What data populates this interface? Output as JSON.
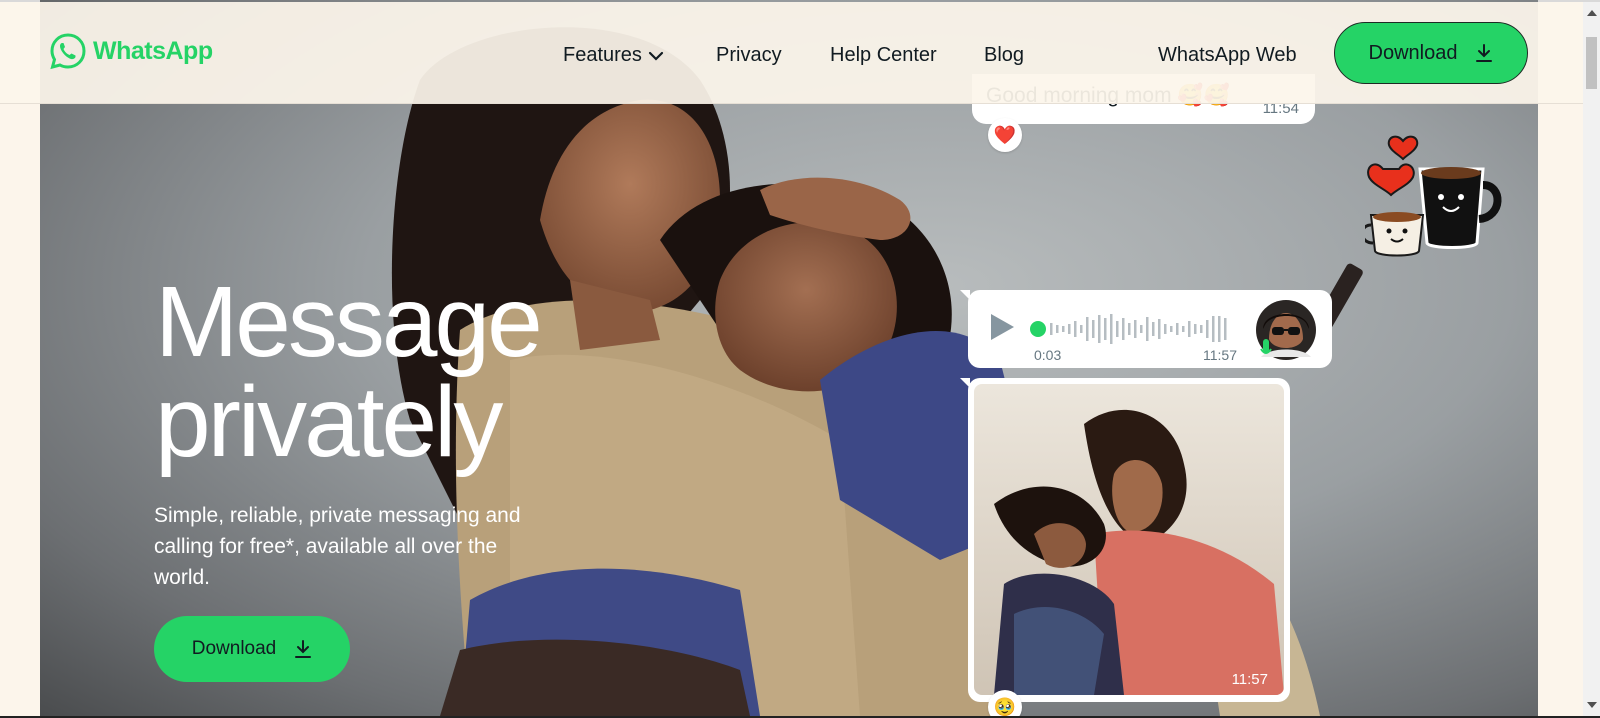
{
  "nav": {
    "logo_text": "WhatsApp",
    "links": [
      "Features",
      "Privacy",
      "Help Center",
      "Blog"
    ],
    "web_link": "WhatsApp Web",
    "download_label": "Download"
  },
  "hero": {
    "title": "Message\nprivately",
    "subtitle": "Simple, reliable, private messaging and calling for free*, available all over the world.",
    "download_label": "Download"
  },
  "chat": {
    "text_message": "Good morning mom 🥰🥰",
    "text_time": "11:54",
    "text_reaction": "❤️",
    "voice_duration": "0:03",
    "voice_time": "11:57",
    "photo_time": "11:57",
    "photo_reaction": "🥹"
  },
  "colors": {
    "brand": "#25d366",
    "background": "#fcf5eb",
    "text_dark": "#111b21"
  }
}
